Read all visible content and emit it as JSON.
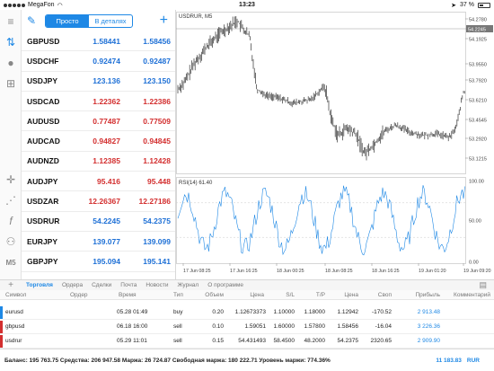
{
  "status_bar": {
    "carrier": "MegaFon",
    "time": "13:23",
    "battery": "37 %"
  },
  "quotes": {
    "mode_simple": "Просто",
    "mode_details": "В деталях",
    "rows": [
      {
        "symbol": "GBPUSD",
        "bid": "1.58441",
        "ask": "1.58456",
        "dir": "up"
      },
      {
        "symbol": "USDCHF",
        "bid": "0.92474",
        "ask": "0.92487",
        "dir": "up"
      },
      {
        "symbol": "USDJPY",
        "bid": "123.136",
        "ask": "123.150",
        "dir": "up"
      },
      {
        "symbol": "USDCAD",
        "bid": "1.22362",
        "ask": "1.22386",
        "dir": "down"
      },
      {
        "symbol": "AUDUSD",
        "bid": "0.77487",
        "ask": "0.77509",
        "dir": "down"
      },
      {
        "symbol": "AUDCAD",
        "bid": "0.94827",
        "ask": "0.94845",
        "dir": "down"
      },
      {
        "symbol": "AUDNZD",
        "bid": "1.12385",
        "ask": "1.12428",
        "dir": "down"
      },
      {
        "symbol": "AUDJPY",
        "bid": "95.416",
        "ask": "95.448",
        "dir": "down"
      },
      {
        "symbol": "USDZAR",
        "bid": "12.26367",
        "ask": "12.27186",
        "dir": "down"
      },
      {
        "symbol": "USDRUR",
        "bid": "54.2245",
        "ask": "54.2375",
        "dir": "up"
      },
      {
        "symbol": "EURJPY",
        "bid": "139.077",
        "ask": "139.099",
        "dir": "up"
      },
      {
        "symbol": "GBPJPY",
        "bid": "195.094",
        "ask": "195.141",
        "dir": "up"
      }
    ]
  },
  "sidebar": {
    "timeframe_label": "M5"
  },
  "chart": {
    "title": "USDRUR, M5",
    "rsi_label": "RSI(14) 61.40",
    "price_ticks": [
      "54.2780",
      "54.2245",
      "54.1925",
      "53.9550",
      "53.7920",
      "53.6210",
      "53.4545",
      "53.2920",
      "53.1215"
    ],
    "current_price": "54.2245",
    "rsi_ticks": [
      "100.00",
      "50.00",
      "0.00"
    ],
    "time_ticks": [
      "17 Jun 08:25",
      "17 Jun 16:25",
      "18 Jun 00:25",
      "18 Jun 08:25",
      "18 Jun 16:25",
      "19 Jun 01:20",
      "19 Jun 09:20"
    ],
    "up_color": "#1e88e5"
  },
  "terminal": {
    "tabs": [
      "Торговля",
      "Ордера",
      "Сделки",
      "Почта",
      "Новости",
      "Журнал",
      "О программе"
    ],
    "active_tab": "Торговля",
    "headers": {
      "symbol": "Символ",
      "order": "Ордер",
      "time": "Время",
      "type": "Тип",
      "volume": "Объем",
      "price": "Цена",
      "sl": "S/L",
      "tp": "T/P",
      "price2": "Цена",
      "swap": "Своп",
      "profit": "Прибыль",
      "comment": "Комментарий"
    },
    "positions": [
      {
        "symbol": "eurusd",
        "time": "05.28 01:49",
        "type": "buy",
        "volume": "0.20",
        "price": "1.12673373",
        "sl": "1.10000",
        "tp": "1.18000",
        "price2": "1.12942",
        "swap": "-170.52",
        "profit": "2 913.48",
        "marker": "#1e88e5"
      },
      {
        "symbol": "gbpusd",
        "time": "06.18 16:00",
        "type": "sell",
        "volume": "0.10",
        "price": "1.59051",
        "sl": "1.60000",
        "tp": "1.57800",
        "price2": "1.58456",
        "swap": "-16.04",
        "profit": "3 226.36",
        "marker": "#d32f2f"
      },
      {
        "symbol": "usdrur",
        "time": "05.29 11:01",
        "type": "sell",
        "volume": "0.15",
        "price": "54.431493",
        "sl": "58.4500",
        "tp": "48.2000",
        "price2": "54.2375",
        "swap": "2320.65",
        "profit": "2 909.90",
        "marker": "#d32f2f"
      }
    ],
    "summary": {
      "balance_text": "Баланс: 195 763.75 Средства: 206 947.58 Маржа: 26 724.87 Свободная маржа: 180 222.71 Уровень маржи: 774.36%",
      "total": "11 183.83",
      "currency": "RUR"
    }
  }
}
